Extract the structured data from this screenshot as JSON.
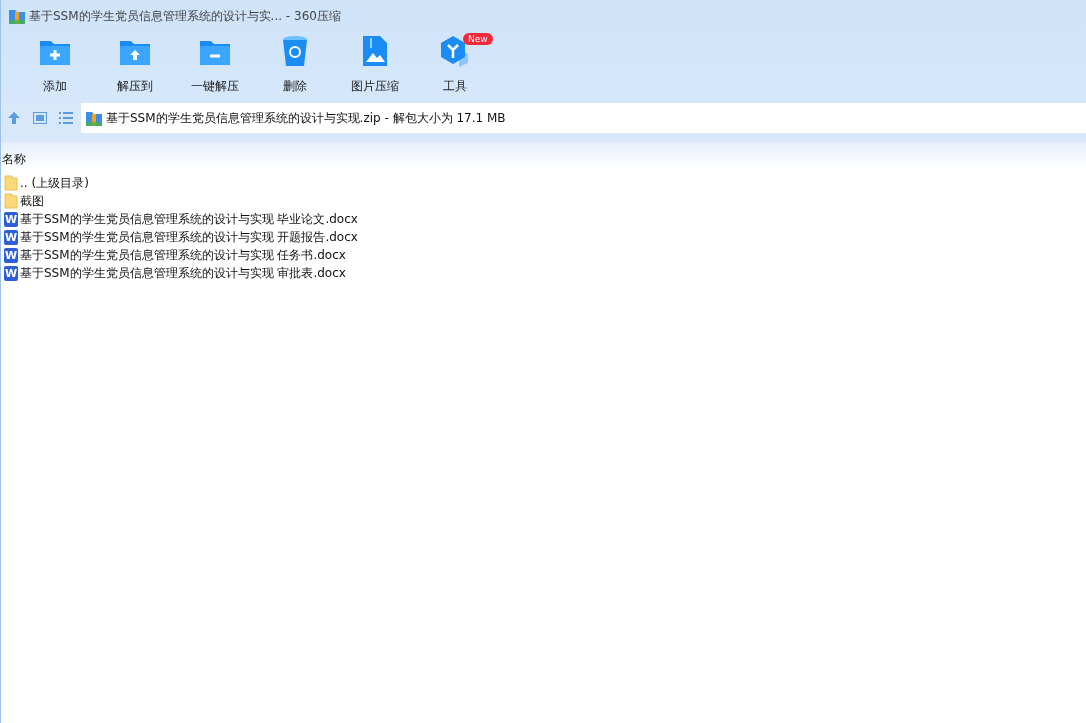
{
  "window": {
    "title": "基于SSM的学生党员信息管理系统的设计与实... - 360压缩"
  },
  "toolbar": [
    {
      "kind": "add",
      "label": "添加"
    },
    {
      "kind": "extract",
      "label": "解压到"
    },
    {
      "kind": "quick",
      "label": "一键解压"
    },
    {
      "kind": "delete",
      "label": "删除"
    },
    {
      "kind": "image",
      "label": "图片压缩"
    },
    {
      "kind": "tools",
      "label": "工具",
      "badge": "New"
    }
  ],
  "address": {
    "text": "基于SSM的学生党员信息管理系统的设计与实现.zip - 解包大小为 17.1 MB"
  },
  "table": {
    "columns": [
      "名称"
    ],
    "rows": [
      {
        "kind": "folder",
        "name": ".. (上级目录)"
      },
      {
        "kind": "folder",
        "name": "截图"
      },
      {
        "kind": "word",
        "icon_text": "W",
        "name": "基于SSM的学生党员信息管理系统的设计与实现 毕业论文.docx"
      },
      {
        "kind": "word",
        "icon_text": "W",
        "name": "基于SSM的学生党员信息管理系统的设计与实现 开题报告.docx"
      },
      {
        "kind": "word",
        "icon_text": "W",
        "name": "基于SSM的学生党员信息管理系统的设计与实现 任务书.docx"
      },
      {
        "kind": "word",
        "icon_text": "W",
        "name": "基于SSM的学生党员信息管理系统的设计与实现 审批表.docx"
      }
    ]
  }
}
